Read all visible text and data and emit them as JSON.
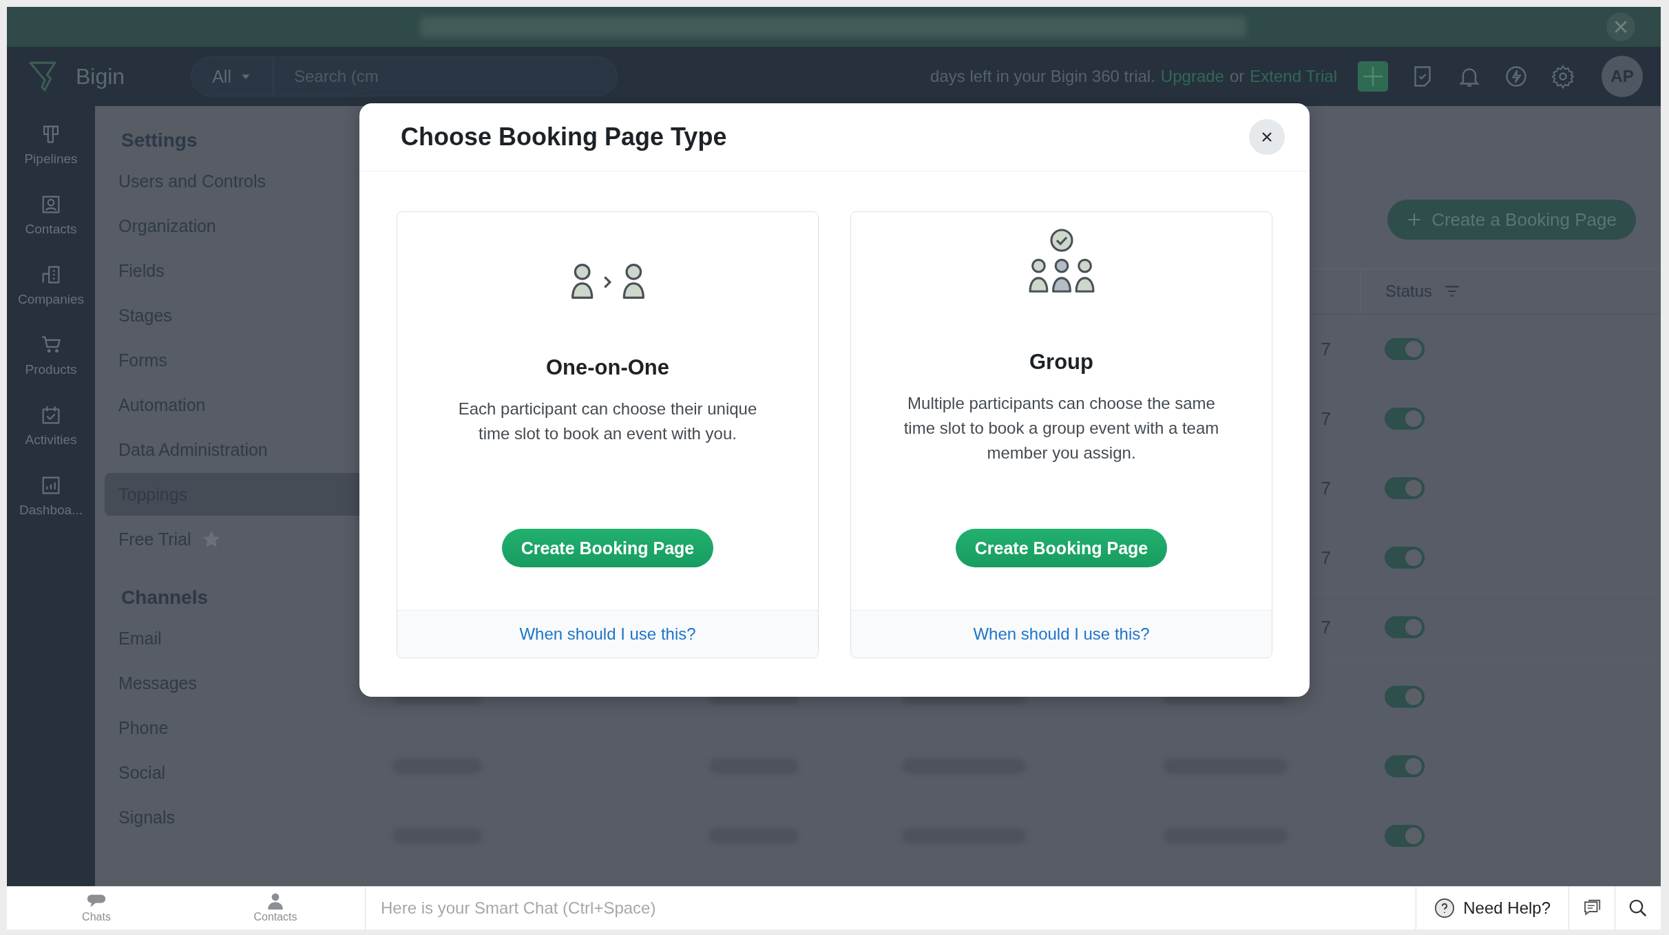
{
  "app": {
    "name": "Bigin"
  },
  "search": {
    "scope": "All",
    "placeholder": "Search (cm"
  },
  "trial_notice": {
    "text": "days left in your Bigin 360 trial.",
    "upgrade_link": "Upgrade",
    "connector": "or",
    "extend_link": "Extend Trial"
  },
  "avatar": {
    "initials": "AP"
  },
  "rail": [
    {
      "label": "Pipelines",
      "kind": "pipelines"
    },
    {
      "label": "Contacts",
      "kind": "contacts"
    },
    {
      "label": "Companies",
      "kind": "companies"
    },
    {
      "label": "Products",
      "kind": "products"
    },
    {
      "label": "Activities",
      "kind": "activities"
    },
    {
      "label": "Dashboa...",
      "kind": "dashboards"
    }
  ],
  "settings": {
    "title": "Settings",
    "items": [
      {
        "label": "Users and Controls",
        "selected": false,
        "starred": false
      },
      {
        "label": "Organization",
        "selected": false,
        "starred": false
      },
      {
        "label": "Fields",
        "selected": false,
        "starred": false
      },
      {
        "label": "Stages",
        "selected": false,
        "starred": false
      },
      {
        "label": "Forms",
        "selected": false,
        "starred": false
      },
      {
        "label": "Automation",
        "selected": false,
        "starred": false
      },
      {
        "label": "Data Administration",
        "selected": false,
        "starred": false
      },
      {
        "label": "Toppings",
        "selected": true,
        "starred": false
      },
      {
        "label": "Free Trial",
        "selected": false,
        "starred": true
      }
    ]
  },
  "channels": {
    "title": "Channels",
    "items": [
      {
        "label": "Email"
      },
      {
        "label": "Messages"
      },
      {
        "label": "Phone"
      },
      {
        "label": "Social"
      },
      {
        "label": "Signals"
      }
    ]
  },
  "create_button": "Create a Booking Page",
  "table": {
    "status_header": "Status",
    "rows": [
      {
        "column_4": "7",
        "on": true
      },
      {
        "column_4": "7",
        "on": true
      },
      {
        "column_4": "7",
        "on": true
      },
      {
        "column_4": "7",
        "on": true
      },
      {
        "column_4": "7",
        "on": true
      },
      {
        "on": true
      },
      {
        "on": true
      },
      {
        "on": true
      }
    ]
  },
  "modal": {
    "title": "Choose Booking Page Type",
    "options": [
      {
        "kind": "one_on_one",
        "title": "One-on-One",
        "description": "Each participant can choose their unique time slot to book an event with you.",
        "button": "Create Booking Page",
        "help_link": "When should I use this?"
      },
      {
        "kind": "group",
        "title": "Group",
        "description": "Multiple participants can choose the same time slot to book a group event with a team member you assign.",
        "button": "Create Booking Page",
        "help_link": "When should I use this?"
      }
    ]
  },
  "bottom_bar": {
    "tabs": [
      {
        "label": "Chats",
        "kind": "chats"
      },
      {
        "label": "Contacts",
        "kind": "contacts"
      }
    ],
    "chat_placeholder": "Here is your Smart Chat (Ctrl+Space)",
    "help": "Need Help?"
  }
}
